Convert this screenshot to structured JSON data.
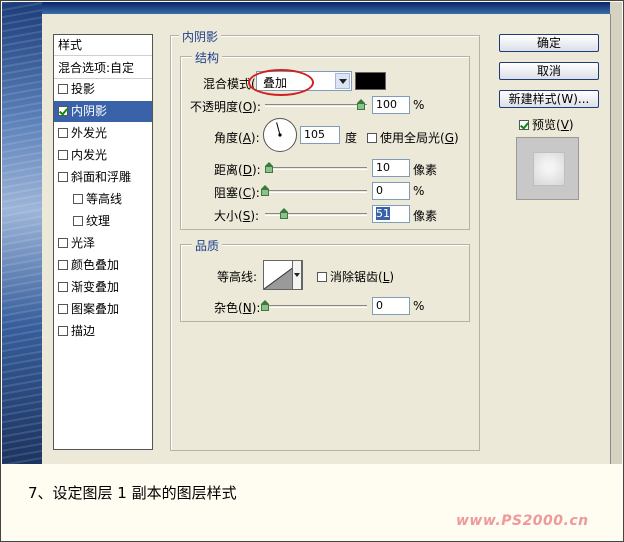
{
  "styles_panel": {
    "header": "样式",
    "blend_options": "混合选项:自定",
    "items": [
      {
        "label": "投影",
        "checked": false
      },
      {
        "label": "内阴影",
        "checked": true,
        "selected": true
      },
      {
        "label": "外发光",
        "checked": false
      },
      {
        "label": "内发光",
        "checked": false
      },
      {
        "label": "斜面和浮雕",
        "checked": false
      },
      {
        "label": "等高线",
        "checked": false,
        "sub": true
      },
      {
        "label": "纹理",
        "checked": false,
        "sub": true
      },
      {
        "label": "光泽",
        "checked": false
      },
      {
        "label": "颜色叠加",
        "checked": false
      },
      {
        "label": "渐变叠加",
        "checked": false
      },
      {
        "label": "图案叠加",
        "checked": false
      },
      {
        "label": "描边",
        "checked": false
      }
    ]
  },
  "inner_shadow": {
    "title": "内阴影",
    "structure": {
      "title": "结构",
      "blend_mode": {
        "label": "混合模式",
        "hotkey": "D",
        "value": "叠加"
      },
      "color": "#000000",
      "opacity": {
        "label": "不透明度",
        "hotkey": "O",
        "value": "100",
        "unit": "%",
        "fraction": 1.0
      },
      "angle": {
        "label": "角度",
        "hotkey": "A",
        "value": "105",
        "unit": "度",
        "degrees": 105
      },
      "global_light": {
        "label": "使用全局光",
        "hotkey": "G",
        "checked": false
      },
      "distance": {
        "label": "距离",
        "hotkey": "D",
        "value": "10",
        "unit": "像素",
        "fraction": 0.04
      },
      "choke": {
        "label": "阻塞",
        "hotkey": "C",
        "value": "0",
        "unit": "%",
        "fraction": 0.0
      },
      "size": {
        "label": "大小",
        "hotkey": "S",
        "value": "51",
        "unit": "像素",
        "fraction": 0.2
      }
    },
    "quality": {
      "title": "品质",
      "contour": {
        "label": "等高线:"
      },
      "anti_alias": {
        "label": "消除锯齿",
        "hotkey": "L",
        "checked": false
      },
      "noise": {
        "label": "杂色",
        "hotkey": "N",
        "value": "0",
        "unit": "%",
        "fraction": 0.0
      }
    }
  },
  "buttons": {
    "ok": "确定",
    "cancel": "取消",
    "new_style": "新建样式(W)...",
    "preview": {
      "label": "预览",
      "hotkey": "V",
      "checked": true
    }
  },
  "caption": "7、设定图层 1 副本的图层样式",
  "watermark": "www.PS2000.cn",
  "colors": {
    "accent": "#3a62a8",
    "legend": "#1f3f8c",
    "highlight_oval": "#d02020"
  }
}
